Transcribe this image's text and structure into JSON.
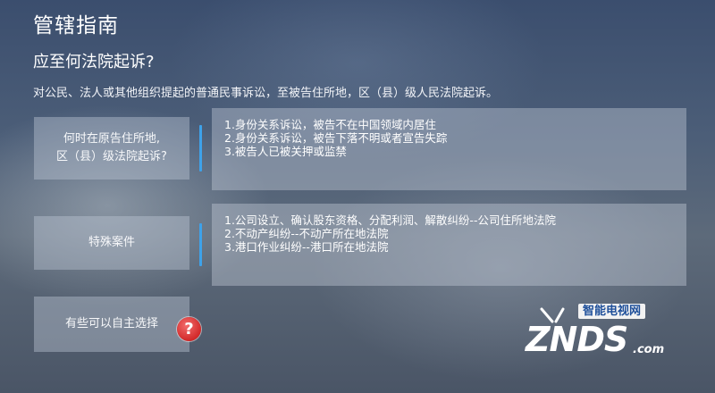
{
  "header": {
    "title": "管辖指南",
    "question": "应至何法院起诉?",
    "description": "对公民、法人或其他组织提起的普通民事诉讼，至被告住所地，区（县）级人民法院起诉。"
  },
  "categories": [
    {
      "label": "何时在原告住所地,\n区（县）级法院起诉?",
      "lines": [
        "1.身份关系诉讼，被告不在中国领域内居住",
        "2.身份关系诉讼，被告下落不明或者宣告失踪",
        "3.被告人已被关押或监禁"
      ]
    },
    {
      "label": "特殊案件",
      "lines": [
        "1.公司设立、确认股东资格、分配利润、解散纠纷--公司住所地法院",
        "2.不动产纠纷--不动产所在地法院",
        "3.港口作业纠纷--港口所在地法院"
      ]
    },
    {
      "label": "有些可以自主选择"
    }
  ],
  "help_icon": {
    "symbol": "?",
    "icon": "question-icon",
    "color": "#d22a2a"
  },
  "watermark": {
    "tagline": "智能电视网",
    "word": "ZNDS",
    "domain": ".com"
  },
  "colors": {
    "accent": "#3ea2ea"
  }
}
